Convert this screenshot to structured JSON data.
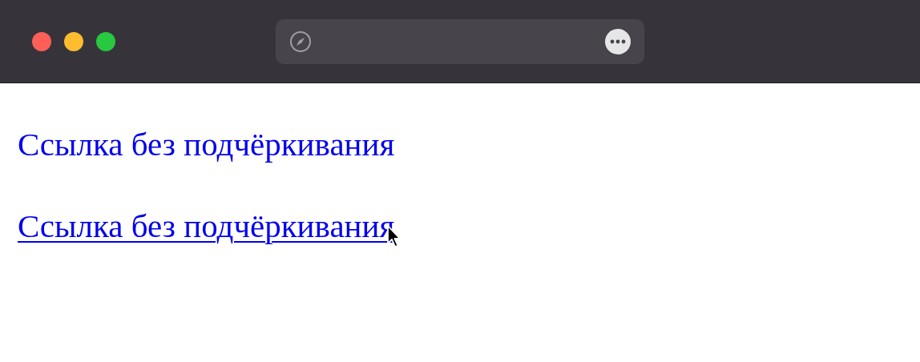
{
  "links": [
    {
      "text": "Ссылка без подчёркивания",
      "underlined": false,
      "hovered": false
    },
    {
      "text": "Ссылка без подчёркивания",
      "underlined": true,
      "hovered": true
    }
  ]
}
